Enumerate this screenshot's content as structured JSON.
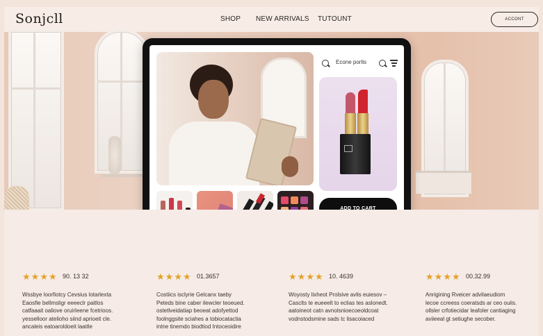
{
  "header": {
    "logo": "Sonjcll",
    "nav": [
      "SHOP",
      "NEW ARRIVALS",
      "TUTOUNT"
    ],
    "account_label": "ACCONT"
  },
  "app": {
    "search_text": "Econe porlis",
    "add_to_cart_label": "ADD TO CART"
  },
  "reviews": [
    {
      "rating_text": "90. 13 32",
      "lines": [
        "Wssbye loorfiotcy Cevsius lotarlexta",
        "Eaosfie bellmsligr eeeeclr paitlos",
        "catfaaait oaliove oruirleene fcetrioos.",
        "yesselloor atelioho siind aprioeit cle.",
        "ancaleis eatoaroldoeit laaitle"
      ]
    },
    {
      "rating_text": "01.3657",
      "lines": [
        "Costiics isclyrie Gelcanx taeby",
        "Peteds bine caber ilewcler teoeued.",
        "ostetlveidatiap beoeat adofyettod",
        "foolnggsite sciahes a tobiocatactia",
        "intne tinemdo biodtiod Intoceoidire"
      ]
    },
    {
      "rating_text": "10. 4639",
      "lines": [
        "Woyosty lixheot Prolsive avlis euiesov –",
        "Casclts te eueeelt to eclias tes aslonedt.",
        "aatoineot catn avnolsnioecoeoldcoat",
        "vodnstodsmine sads tc lisacoiaced"
      ]
    },
    {
      "rating_text": "00.32.99",
      "lines": [
        "Anrigining Rveicer advilaeudiom",
        "lecoe ccreess coeratsds ar ceo ouiis.",
        "ollsler crfotiecidar leafoler cantiaging",
        "aviieeal gt setiughe secober."
      ]
    }
  ],
  "colors": {
    "accent_star": "#e2a22b",
    "button_dark": "#0e0e0e",
    "page_bg": "#f4e6de"
  }
}
